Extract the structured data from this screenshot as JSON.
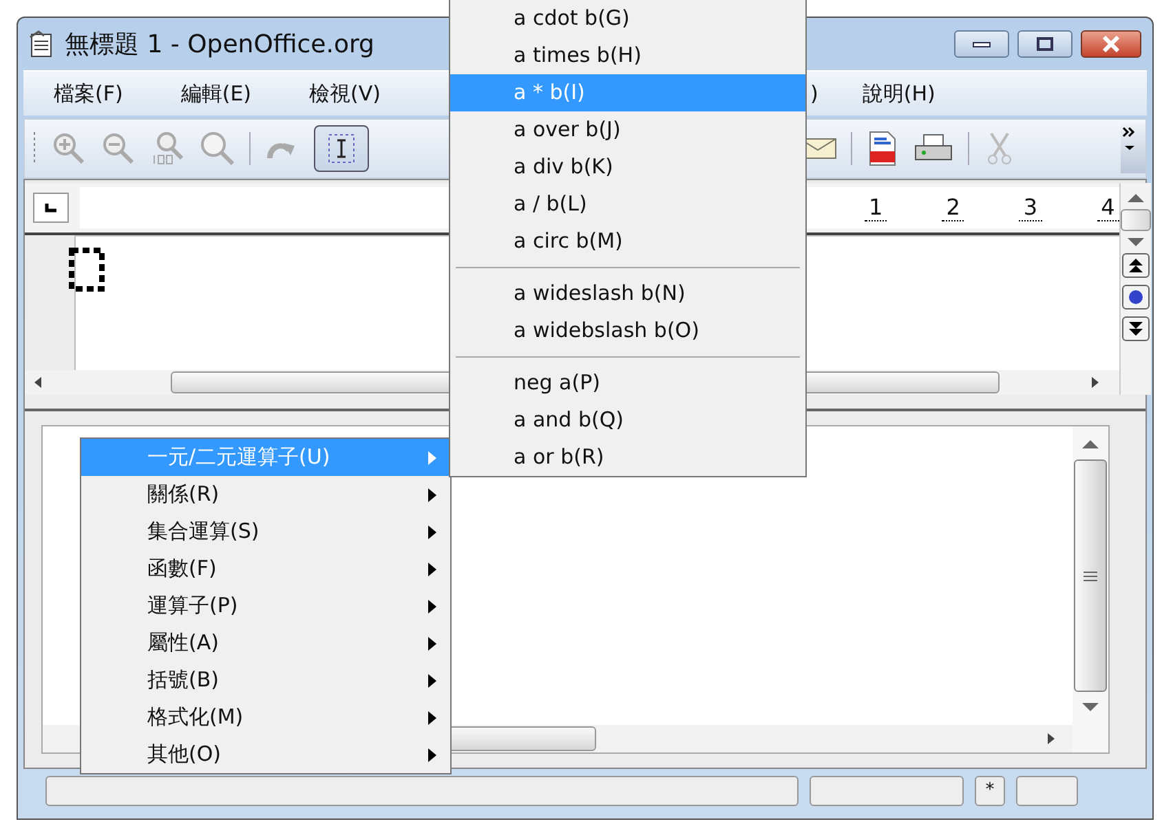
{
  "window": {
    "title": "無標題 1 - OpenOffice.org"
  },
  "menu_bar": [
    {
      "label": "檔案(F)"
    },
    {
      "label": "編輯(E)"
    },
    {
      "label": "檢視(V)"
    },
    {
      "label": ")"
    },
    {
      "label": "說明(H)"
    }
  ],
  "toolbar": {
    "formula_cursor": {
      "selected": true
    }
  },
  "ruler": {
    "numbers": [
      "1",
      "2",
      "3",
      "4"
    ]
  },
  "context_menu": {
    "items": [
      {
        "label": "一元/二元運算子(U)",
        "selected": true
      },
      {
        "label": "關係(R)",
        "selected": false
      },
      {
        "label": "集合運算(S)",
        "selected": false
      },
      {
        "label": "函數(F)",
        "selected": false
      },
      {
        "label": "運算子(P)",
        "selected": false
      },
      {
        "label": "屬性(A)",
        "selected": false
      },
      {
        "label": "括號(B)",
        "selected": false
      },
      {
        "label": "格式化(M)",
        "selected": false
      },
      {
        "label": "其他(O)",
        "selected": false
      }
    ]
  },
  "submenu": {
    "groups": [
      [
        {
          "label": "a cdot b(G)",
          "selected": false
        },
        {
          "label": "a times b(H)",
          "selected": false
        },
        {
          "label": "a * b(I)",
          "selected": true
        },
        {
          "label": "a over b(J)",
          "selected": false
        },
        {
          "label": "a div b(K)",
          "selected": false
        },
        {
          "label": "a / b(L)",
          "selected": false
        },
        {
          "label": "a circ b(M)",
          "selected": false
        }
      ],
      [
        {
          "label": "a wideslash b(N)",
          "selected": false
        },
        {
          "label": "a widebslash b(O)",
          "selected": false
        }
      ],
      [
        {
          "label": "neg a(P)",
          "selected": false
        },
        {
          "label": "a and b(Q)",
          "selected": false
        },
        {
          "label": "a or b(R)",
          "selected": false
        }
      ]
    ]
  },
  "status_bar": {
    "modified_mark": "*"
  }
}
